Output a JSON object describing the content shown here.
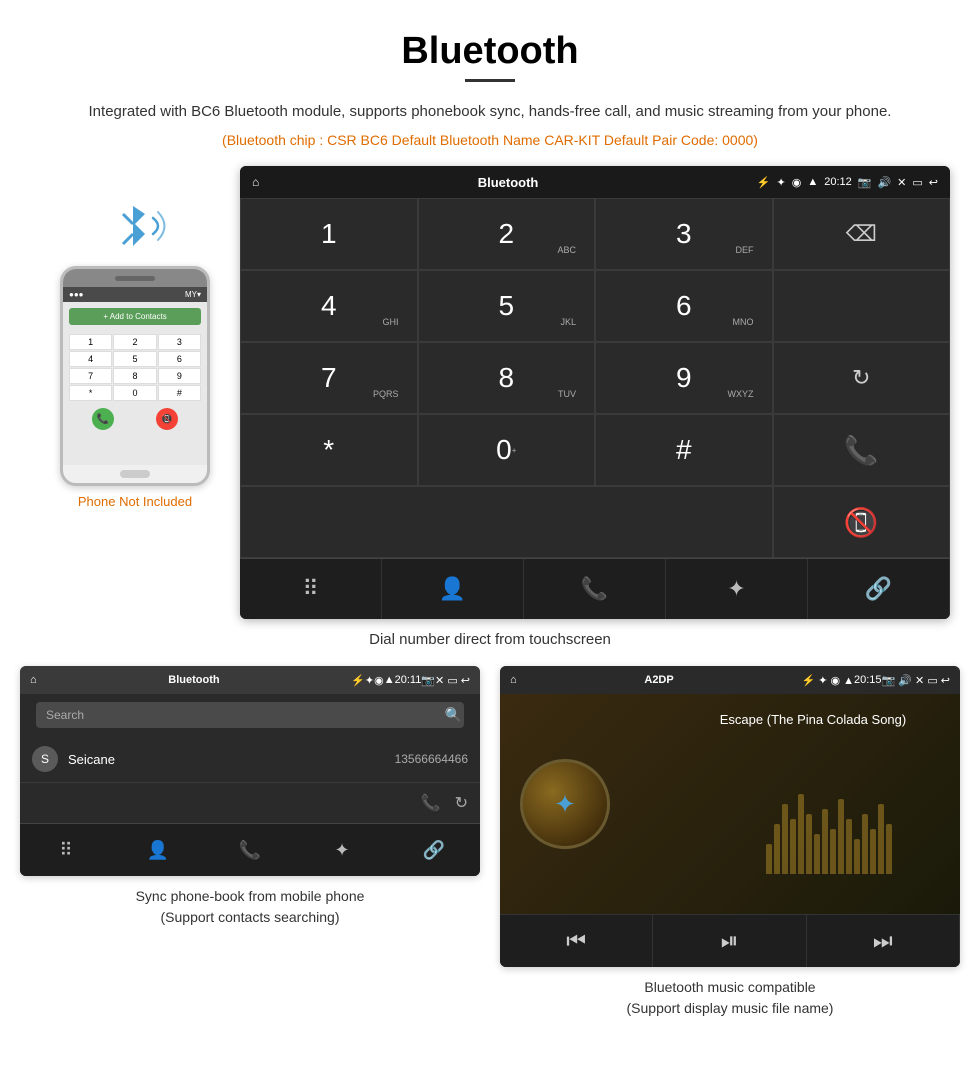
{
  "header": {
    "title": "Bluetooth",
    "subtitle": "Integrated with BC6 Bluetooth module, supports phonebook sync, hands-free call, and music streaming from your phone.",
    "chip_info": "(Bluetooth chip : CSR BC6    Default Bluetooth Name CAR-KIT    Default Pair Code: 0000)"
  },
  "phone_side": {
    "not_included": "Phone Not Included"
  },
  "dialpad_screen": {
    "statusbar": {
      "app_name": "Bluetooth",
      "time": "20:12"
    },
    "caption": "Dial number direct from touchscreen",
    "keys": [
      {
        "main": "1",
        "sub": ""
      },
      {
        "main": "2",
        "sub": "ABC"
      },
      {
        "main": "3",
        "sub": "DEF"
      },
      {
        "main": "",
        "sub": "backspace"
      },
      {
        "main": "4",
        "sub": "GHI"
      },
      {
        "main": "5",
        "sub": "JKL"
      },
      {
        "main": "6",
        "sub": "MNO"
      },
      {
        "main": "",
        "sub": ""
      },
      {
        "main": "7",
        "sub": "PQRS"
      },
      {
        "main": "8",
        "sub": "TUV"
      },
      {
        "main": "9",
        "sub": "WXYZ"
      },
      {
        "main": "",
        "sub": "refresh"
      },
      {
        "main": "*",
        "sub": ""
      },
      {
        "main": "0",
        "sub": "+"
      },
      {
        "main": "#",
        "sub": ""
      },
      {
        "main": "",
        "sub": "call_green"
      },
      {
        "main": "",
        "sub": "call_red"
      }
    ]
  },
  "phonebook_screen": {
    "statusbar": {
      "app_name": "Bluetooth",
      "time": "20:11"
    },
    "search_placeholder": "Search",
    "contact": {
      "letter": "S",
      "name": "Seicane",
      "number": "13566664466"
    },
    "caption_line1": "Sync phone-book from mobile phone",
    "caption_line2": "(Support contacts searching)"
  },
  "music_screen": {
    "statusbar": {
      "app_name": "A2DP",
      "time": "20:15"
    },
    "song_title": "Escape (The Pina Colada Song)",
    "caption_line1": "Bluetooth music compatible",
    "caption_line2": "(Support display music file name)"
  },
  "colors": {
    "orange": "#e06c00",
    "green": "#4CAF50",
    "red": "#f44336",
    "accent_blue": "#4a9fd4"
  }
}
